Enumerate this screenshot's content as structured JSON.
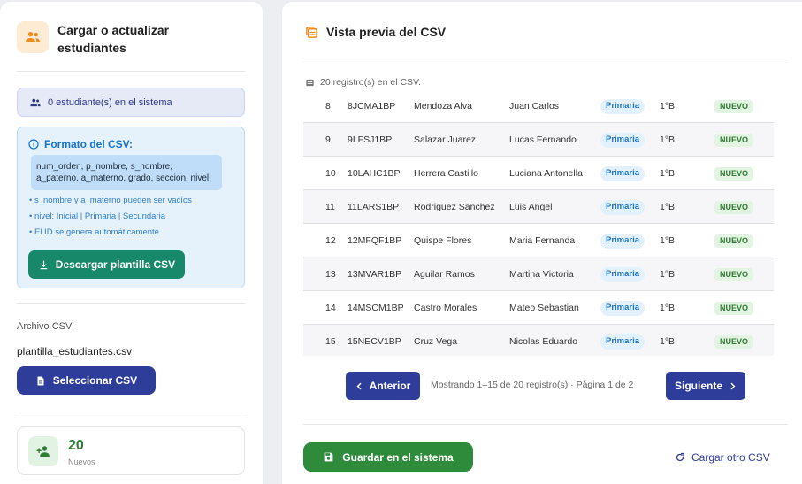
{
  "left": {
    "header_title": "Cargar o actualizar estudiantes",
    "student_count": "0 estudiante(s) en el sistema",
    "format": {
      "title": "Formato del CSV:",
      "columns_line1": "num_orden, p_nombre, s_nombre,",
      "columns_line2": "a_paterno, a_materno, grado, seccion, nivel",
      "notes": [
        "• s_nombre y a_materno pueden ser vacíos",
        "• nivel: Inicial | Primaria | Secundaria",
        "• El ID se genera automáticamente"
      ],
      "download_label": "Descargar plantilla CSV"
    },
    "file_label": "Archivo CSV:",
    "file_name": "plantilla_estudiantes.csv",
    "select_label": "Seleccionar CSV",
    "stat": {
      "value": "20",
      "label": "Nuevos"
    }
  },
  "preview": {
    "title": "Vista previa del CSV",
    "record_count": "20 registro(s) en el CSV.",
    "rows": [
      {
        "num": "8",
        "id": "8JCMA1BP",
        "apellidos": "Mendoza Alva",
        "nombres": "Juan Carlos",
        "nivel": "Primaria",
        "grado": "1°B",
        "estado": "NUEVO"
      },
      {
        "num": "9",
        "id": "9LFSJ1BP",
        "apellidos": "Salazar Juarez",
        "nombres": "Lucas Fernando",
        "nivel": "Primaria",
        "grado": "1°B",
        "estado": "NUEVO"
      },
      {
        "num": "10",
        "id": "10LAHC1BP",
        "apellidos": "Herrera Castillo",
        "nombres": "Luciana Antonella",
        "nivel": "Primaria",
        "grado": "1°B",
        "estado": "NUEVO"
      },
      {
        "num": "11",
        "id": "11LARS1BP",
        "apellidos": "Rodriguez Sanchez",
        "nombres": "Luis Angel",
        "nivel": "Primaria",
        "grado": "1°B",
        "estado": "NUEVO"
      },
      {
        "num": "12",
        "id": "12MFQF1BP",
        "apellidos": "Quispe Flores",
        "nombres": "Maria Fernanda",
        "nivel": "Primaria",
        "grado": "1°B",
        "estado": "NUEVO"
      },
      {
        "num": "13",
        "id": "13MVAR1BP",
        "apellidos": "Aguilar Ramos",
        "nombres": "Martina Victoria",
        "nivel": "Primaria",
        "grado": "1°B",
        "estado": "NUEVO"
      },
      {
        "num": "14",
        "id": "14MSCM1BP",
        "apellidos": "Castro Morales",
        "nombres": "Mateo Sebastian",
        "nivel": "Primaria",
        "grado": "1°B",
        "estado": "NUEVO"
      },
      {
        "num": "15",
        "id": "15NECV1BP",
        "apellidos": "Cruz Vega",
        "nombres": "Nicolas Eduardo",
        "nivel": "Primaria",
        "grado": "1°B",
        "estado": "NUEVO"
      }
    ],
    "pager": {
      "prev_label": "Anterior",
      "info": "Mostrando 1–15 de 20 registro(s)  ·  Página 1 de 2",
      "next_label": "Siguiente"
    },
    "save_label": "Guardar en el sistema",
    "reload_label": "Cargar otro CSV"
  }
}
